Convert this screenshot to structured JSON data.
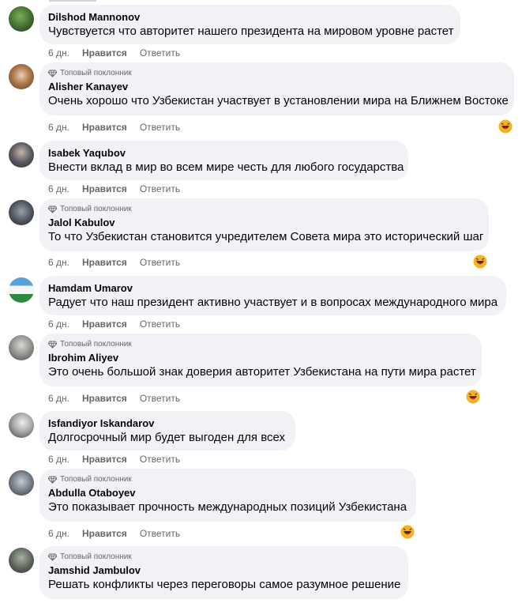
{
  "comments": [
    {
      "author": "Dilshod Mannonov",
      "text": "Чувствуется что авторитет нашего президента на мировом уровне растет",
      "badge": "",
      "time": "6 дн.",
      "like": "Нравится",
      "reply": "Ответить"
    },
    {
      "author": "Alisher Kanayev",
      "text": "Очень хорошо что Узбекистан участвует в установлении мира на Ближнем Востоке",
      "badge": "Топовый поклонник",
      "time": "6 дн.",
      "like": "Нравится",
      "reply": "Ответить",
      "reaction": "haha"
    },
    {
      "author": "Isabek Yaqubov",
      "text": "Внести вклад в мир во всем мире честь для любого государства",
      "badge": "",
      "time": "6 дн.",
      "like": "Нравится",
      "reply": "Ответить"
    },
    {
      "author": "Jalol Kabulov",
      "text": "То что Узбекистан становится учредителем Совета мира это исторический шаг",
      "badge": "Топовый поклонник",
      "time": "6 дн.",
      "like": "Нравится",
      "reply": "Ответить",
      "reaction": "haha"
    },
    {
      "author": "Hamdam Umarov",
      "text": "Радует что наш президент активно участвует и в вопросах международного мира",
      "badge": "",
      "time": "6 дн.",
      "like": "Нравится",
      "reply": "Ответить"
    },
    {
      "author": "Ibrohim Aliyev",
      "text": "Это очень большой знак доверия авторитет Узбекистана на пути мира растет",
      "badge": "Топовый поклонник",
      "time": "6 дн.",
      "like": "Нравится",
      "reply": "Ответить",
      "reaction": "haha"
    },
    {
      "author": "Isfandiyor Iskandarov",
      "text": "Долгосрочный мир будет выгоден для всех",
      "badge": "",
      "time": "6 дн.",
      "like": "Нравится",
      "reply": "Ответить"
    },
    {
      "author": "Abdulla Otaboyev",
      "text": "Это показывает прочность международных позиций Узбекистана",
      "badge": "Топовый поклонник",
      "time": "6 дн.",
      "like": "Нравится",
      "reply": "Ответить",
      "reaction": "haha"
    },
    {
      "author": "Jamshid Jambulov",
      "text": "Решать конфликты через переговоры самое разумное решение",
      "badge": "Топовый поклонник",
      "time": "",
      "like": "",
      "reply": ""
    }
  ],
  "colors": {
    "bubble": "#f0f2f5",
    "meta": "#65676b",
    "reaction": "#f7b125"
  },
  "icons": {
    "badge": "diamond-icon",
    "reaction": "haha-reaction-icon"
  }
}
